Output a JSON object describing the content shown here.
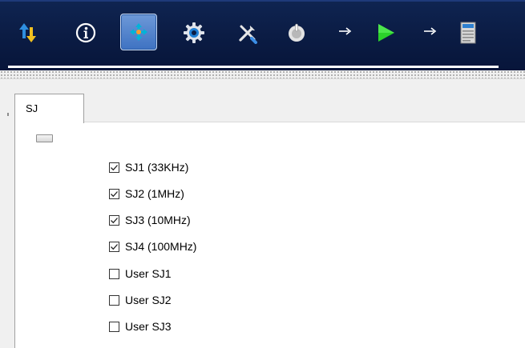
{
  "toolbar": {
    "buttons": [
      {
        "name": "transfer-arrows-icon"
      },
      {
        "name": "info-icon"
      },
      {
        "name": "move-crosshair-icon",
        "active": true
      },
      {
        "name": "gear-icon"
      },
      {
        "name": "tools-icon"
      },
      {
        "name": "power-knob-icon"
      },
      {
        "name": "arrow-right-icon"
      },
      {
        "name": "play-icon"
      },
      {
        "name": "arrow-right-icon"
      },
      {
        "name": "document-icon"
      }
    ],
    "colors": {
      "background": "#0b1c44",
      "active": "#4f80cc",
      "play": "#2bd12b"
    }
  },
  "tab": {
    "label": "SJ"
  },
  "checkboxes": [
    {
      "label": "SJ1 (33KHz)",
      "checked": true
    },
    {
      "label": "SJ2 (1MHz)",
      "checked": true
    },
    {
      "label": "SJ3 (10MHz)",
      "checked": true
    },
    {
      "label": "SJ4 (100MHz)",
      "checked": true
    },
    {
      "label": "User SJ1",
      "checked": false
    },
    {
      "label": "User SJ2",
      "checked": false
    },
    {
      "label": "User SJ3",
      "checked": false
    }
  ]
}
